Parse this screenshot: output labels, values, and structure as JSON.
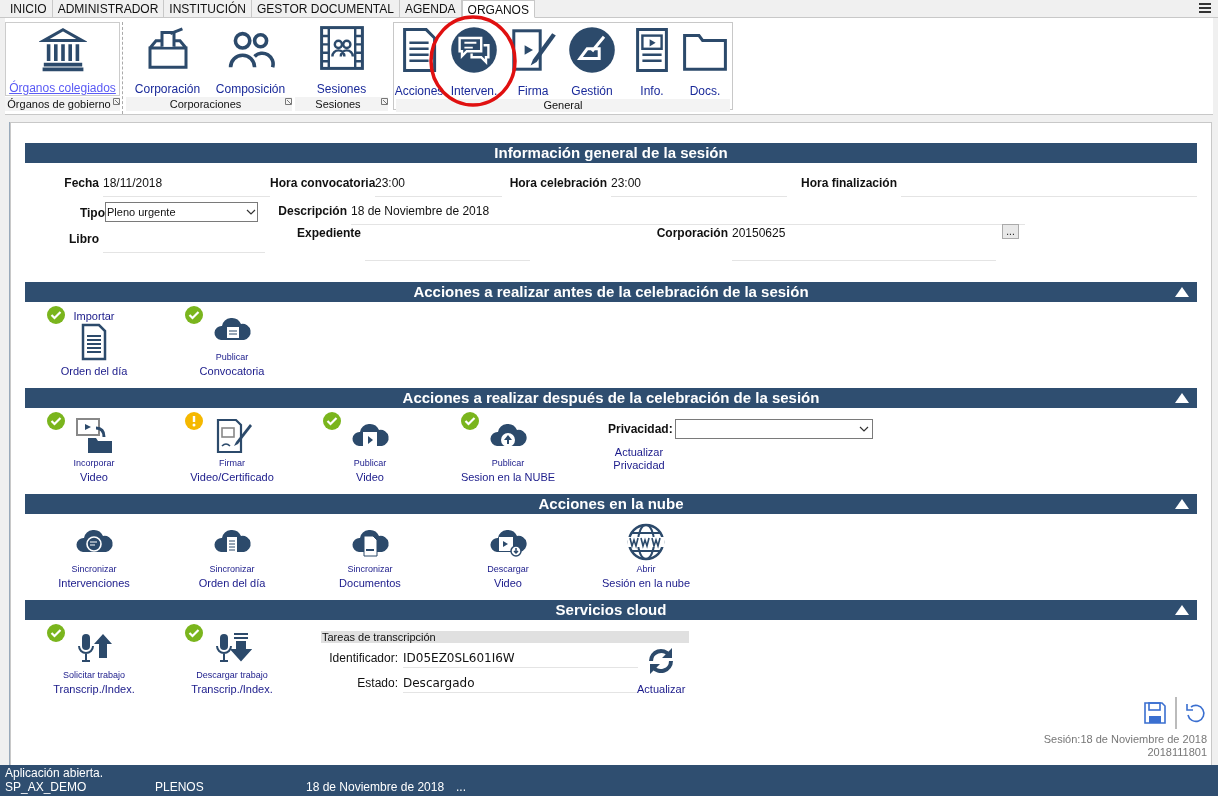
{
  "menu_tabs": [
    {
      "label": "INICIO",
      "selected": false
    },
    {
      "label": "ADMINISTRADOR",
      "selected": false
    },
    {
      "label": "INSTITUCIÓN",
      "selected": false
    },
    {
      "label": "GESTOR DOCUMENTAL",
      "selected": false
    },
    {
      "label": "AGENDA",
      "selected": false
    },
    {
      "label": "ORGANOS",
      "selected": true
    }
  ],
  "ribbon_groups": [
    {
      "label": "Órganos de gobierno",
      "items": [
        {
          "label": "Órganos colegiados",
          "selected": true
        }
      ]
    },
    {
      "label": "Corporaciones",
      "items": [
        {
          "label": "Corporación",
          "selected": false
        },
        {
          "label": "Composición",
          "selected": false
        }
      ]
    },
    {
      "label": "Sesiones",
      "items": [
        {
          "label": "Sesiones",
          "selected": false
        }
      ]
    },
    {
      "label": "General",
      "items": [
        {
          "label": "Acciones",
          "selected": false
        },
        {
          "label": "Interven.",
          "selected": false
        },
        {
          "label": "Firma",
          "selected": false
        },
        {
          "label": "Gestión",
          "selected": false
        },
        {
          "label": "Info.",
          "selected": false
        },
        {
          "label": "Docs.",
          "selected": false
        }
      ]
    }
  ],
  "info": {
    "title": "Información general de la sesión",
    "fecha": {
      "label": "Fecha",
      "value": "18/11/2018"
    },
    "hora_convocatoria": {
      "label": "Hora convocatoria",
      "value": "23:00"
    },
    "hora_celebracion": {
      "label": "Hora celebración",
      "value": "23:00"
    },
    "hora_finalizacion": {
      "label": "Hora finalización"
    },
    "tipo": {
      "label": "Tipo",
      "value": "Pleno urgente"
    },
    "descripcion": {
      "label": "Descripción",
      "value": "18 de Noviembre de 2018"
    },
    "libro": {
      "label": "Libro"
    },
    "expediente": {
      "label": "Expediente"
    },
    "corporacion": {
      "label": "Corporación",
      "value": "20150625",
      "button": "..."
    }
  },
  "sections": [
    {
      "title": "Acciones a realizar antes de la celebración de la sesión",
      "expanded": true,
      "actions": [
        {
          "kind": "caption-above",
          "caption": "Importar",
          "label": "Orden del día",
          "completed": true
        },
        {
          "kind": "caption-below",
          "caption": "Publicar",
          "label": "Convocatoria",
          "completed": true
        }
      ]
    },
    {
      "title": "Acciones a realizar después de la celebración de la sesión",
      "expanded": true,
      "actions": [
        {
          "kind": "caption-below",
          "caption": "Incorporar",
          "label": "Video",
          "completed": true
        },
        {
          "kind": "caption-below",
          "caption": "Firmar",
          "label": "Video/Certificado",
          "completed": false
        },
        {
          "kind": "caption-below",
          "caption": "Publicar",
          "label": "Video",
          "completed": true
        },
        {
          "kind": "caption-below",
          "caption": "Publicar",
          "label": "Sesion en la NUBE",
          "completed": true
        }
      ],
      "privacy": {
        "label": "Privacidad:",
        "link": "Actualizar Privacidad"
      }
    },
    {
      "title": "Acciones en la nube",
      "expanded": true,
      "actions": [
        {
          "kind": "caption-below",
          "caption": "Sincronizar",
          "label": "Intervenciones"
        },
        {
          "kind": "caption-below",
          "caption": "Sincronizar",
          "label": "Orden del día"
        },
        {
          "kind": "caption-below",
          "caption": "Sincronizar",
          "label": "Documentos"
        },
        {
          "kind": "caption-below",
          "caption": "Descargar",
          "label": "Video"
        },
        {
          "kind": "caption-below",
          "caption": "Abrir",
          "label": "Sesión en la nube"
        }
      ]
    },
    {
      "title": "Servicios cloud",
      "expanded": true,
      "actions": [
        {
          "kind": "caption-below",
          "caption": "Solicitar trabajo",
          "label": "Transcrip./Index.",
          "completed": true
        },
        {
          "kind": "caption-below",
          "caption": "Descargar trabajo",
          "label": "Transcrip./Index.",
          "completed": true
        }
      ],
      "tasks": {
        "title": "Tareas de transcripción",
        "id_label": "Identificador:",
        "id_value": "ID05EZ0SL601I6W",
        "state_label": "Estado:",
        "state_value": "Descargado",
        "refresh": "Actualizar"
      }
    }
  ],
  "footer": {
    "session": "Sesión:18 de Noviembre de 2018",
    "code": "2018111801"
  },
  "status_bar": {
    "message": "Aplicación abierta.",
    "user": "SP_AX_DEMO",
    "module": "PLENOS",
    "date": "18 de Noviembre de 2018",
    "more": "..."
  }
}
